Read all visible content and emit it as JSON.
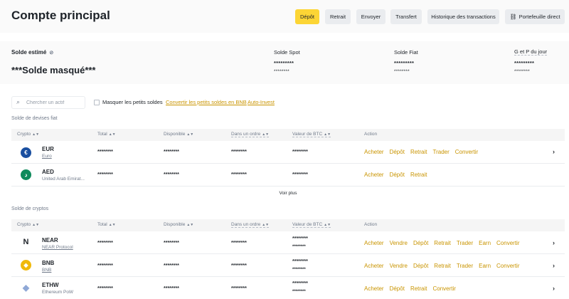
{
  "header": {
    "title": "Compte principal",
    "buttons": {
      "deposit": "Dépôt",
      "withdraw": "Retrait",
      "send": "Envoyer",
      "transfer": "Transfert",
      "history": "Historique des transactions",
      "wallet": "Portefeuille direct"
    }
  },
  "balance": {
    "estimated_label": "Solde estimé",
    "masked_text": "***Solde masqué***",
    "spot_label": "Solde Spot",
    "spot_value": "*********",
    "spot_sub": "********",
    "fiat_label": "Solde Fiat",
    "fiat_value": "*********",
    "fiat_sub": "********",
    "pnl_label": "G et P du jour",
    "pnl_value": "*********",
    "pnl_sub": "********"
  },
  "toolbar": {
    "search_placeholder": "Chercher un actif",
    "hide_small_label": "Masquer les petits soldes",
    "convert_link": "Convertir les petits soldes en BNB",
    "autoinvest_link": "Auto-Invest"
  },
  "fiat_section": {
    "title": "Solde de devises fiat",
    "columns": [
      "Crypto",
      "Total",
      "Disponible",
      "Dans un ordre",
      "Valeur de BTC",
      "Action"
    ],
    "rows": [
      {
        "symbol": "EUR",
        "name": "Euro",
        "icon_glyph": "€",
        "icon_color": "#1a4fa0",
        "total": "********",
        "available": "********",
        "in_order": "********",
        "btc": "********",
        "actions": [
          "Acheter",
          "Dépôt",
          "Retrait",
          "Trader",
          "Convertir"
        ]
      },
      {
        "symbol": "AED",
        "name": "United Arab Emirat...",
        "icon_glyph": "د",
        "icon_color": "#0e8a5b",
        "total": "********",
        "available": "********",
        "in_order": "********",
        "btc": "********",
        "actions": [
          "Acheter",
          "Dépôt",
          "Retrait"
        ]
      }
    ],
    "see_more": "Voir plus"
  },
  "crypto_section": {
    "title": "Solde de cryptos",
    "columns": [
      "Crypto",
      "Total",
      "Disponible",
      "Dans un ordre",
      "Valeur de BTC",
      "Action"
    ],
    "rows": [
      {
        "symbol": "NEAR",
        "name": "NEAR Protocol",
        "icon_glyph": "N",
        "icon_color": "#1e2329",
        "total": "********",
        "available": "********",
        "in_order": "********",
        "btc": "********",
        "btc_sub": "********",
        "actions": [
          "Acheter",
          "Vendre",
          "Dépôt",
          "Retrait",
          "Trader",
          "Earn",
          "Convertir"
        ]
      },
      {
        "symbol": "BNB",
        "name": "BNB",
        "icon_glyph": "◆",
        "icon_color": "#f0b90b",
        "total": "********",
        "available": "********",
        "in_order": "********",
        "btc": "********",
        "btc_sub": "********",
        "actions": [
          "Acheter",
          "Vendre",
          "Dépôt",
          "Retrait",
          "Trader",
          "Earn",
          "Convertir"
        ]
      },
      {
        "symbol": "ETHW",
        "name": "Ethereum PoW",
        "icon_glyph": "◆",
        "icon_color": "#8fa8d6",
        "total": "********",
        "available": "********",
        "in_order": "********",
        "btc": "********",
        "btc_sub": "********",
        "actions": [
          "Acheter",
          "Dépôt",
          "Retrait",
          "Convertir"
        ]
      }
    ]
  },
  "colors": {
    "accent": "#fcd535",
    "link": "#c99400",
    "text": "#1e2329",
    "muted": "#707a8a"
  }
}
